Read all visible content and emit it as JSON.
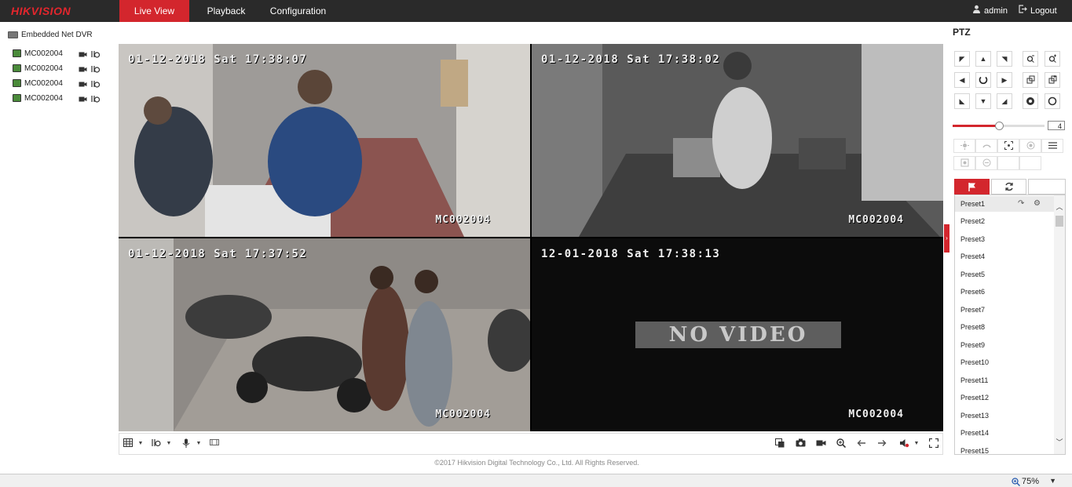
{
  "header": {
    "logo": "HIKVISION",
    "nav": [
      {
        "label": "Live View",
        "active": true
      },
      {
        "label": "Playback",
        "active": false
      },
      {
        "label": "Configuration",
        "active": false
      }
    ],
    "user": "admin",
    "logout": "Logout"
  },
  "tree": {
    "root": "Embedded Net DVR",
    "cameras": [
      "MC002004",
      "MC002004",
      "MC002004",
      "MC002004"
    ]
  },
  "video": {
    "tiles": [
      {
        "timestamp": "01-12-2018 Sat 17:38:07",
        "channel": "MC002004",
        "selected": true,
        "no_video": false
      },
      {
        "timestamp": "01-12-2018 Sat 17:38:02",
        "channel": "MC002004",
        "selected": false,
        "no_video": false
      },
      {
        "timestamp": "01-12-2018 Sat 17:37:52",
        "channel": "MC002004",
        "selected": false,
        "no_video": false
      },
      {
        "timestamp": "12-01-2018 Sat 17:38:13",
        "channel": "MC002004",
        "selected": false,
        "no_video": true,
        "no_video_text": "NO VIDEO"
      }
    ]
  },
  "ptz": {
    "title": "PTZ",
    "speed": "4",
    "speed_level": 0.5,
    "presets": [
      "Preset1",
      "Preset2",
      "Preset3",
      "Preset4",
      "Preset5",
      "Preset6",
      "Preset7",
      "Preset8",
      "Preset9",
      "Preset10",
      "Preset11",
      "Preset12",
      "Preset13",
      "Preset14",
      "Preset15"
    ]
  },
  "footer": "©2017 Hikvision Digital Technology Co., Ltd. All Rights Reserved.",
  "statusbar": {
    "zoom": "75%"
  },
  "colors": {
    "brand_red": "#d3262d",
    "topbar": "#2a2a2a"
  }
}
